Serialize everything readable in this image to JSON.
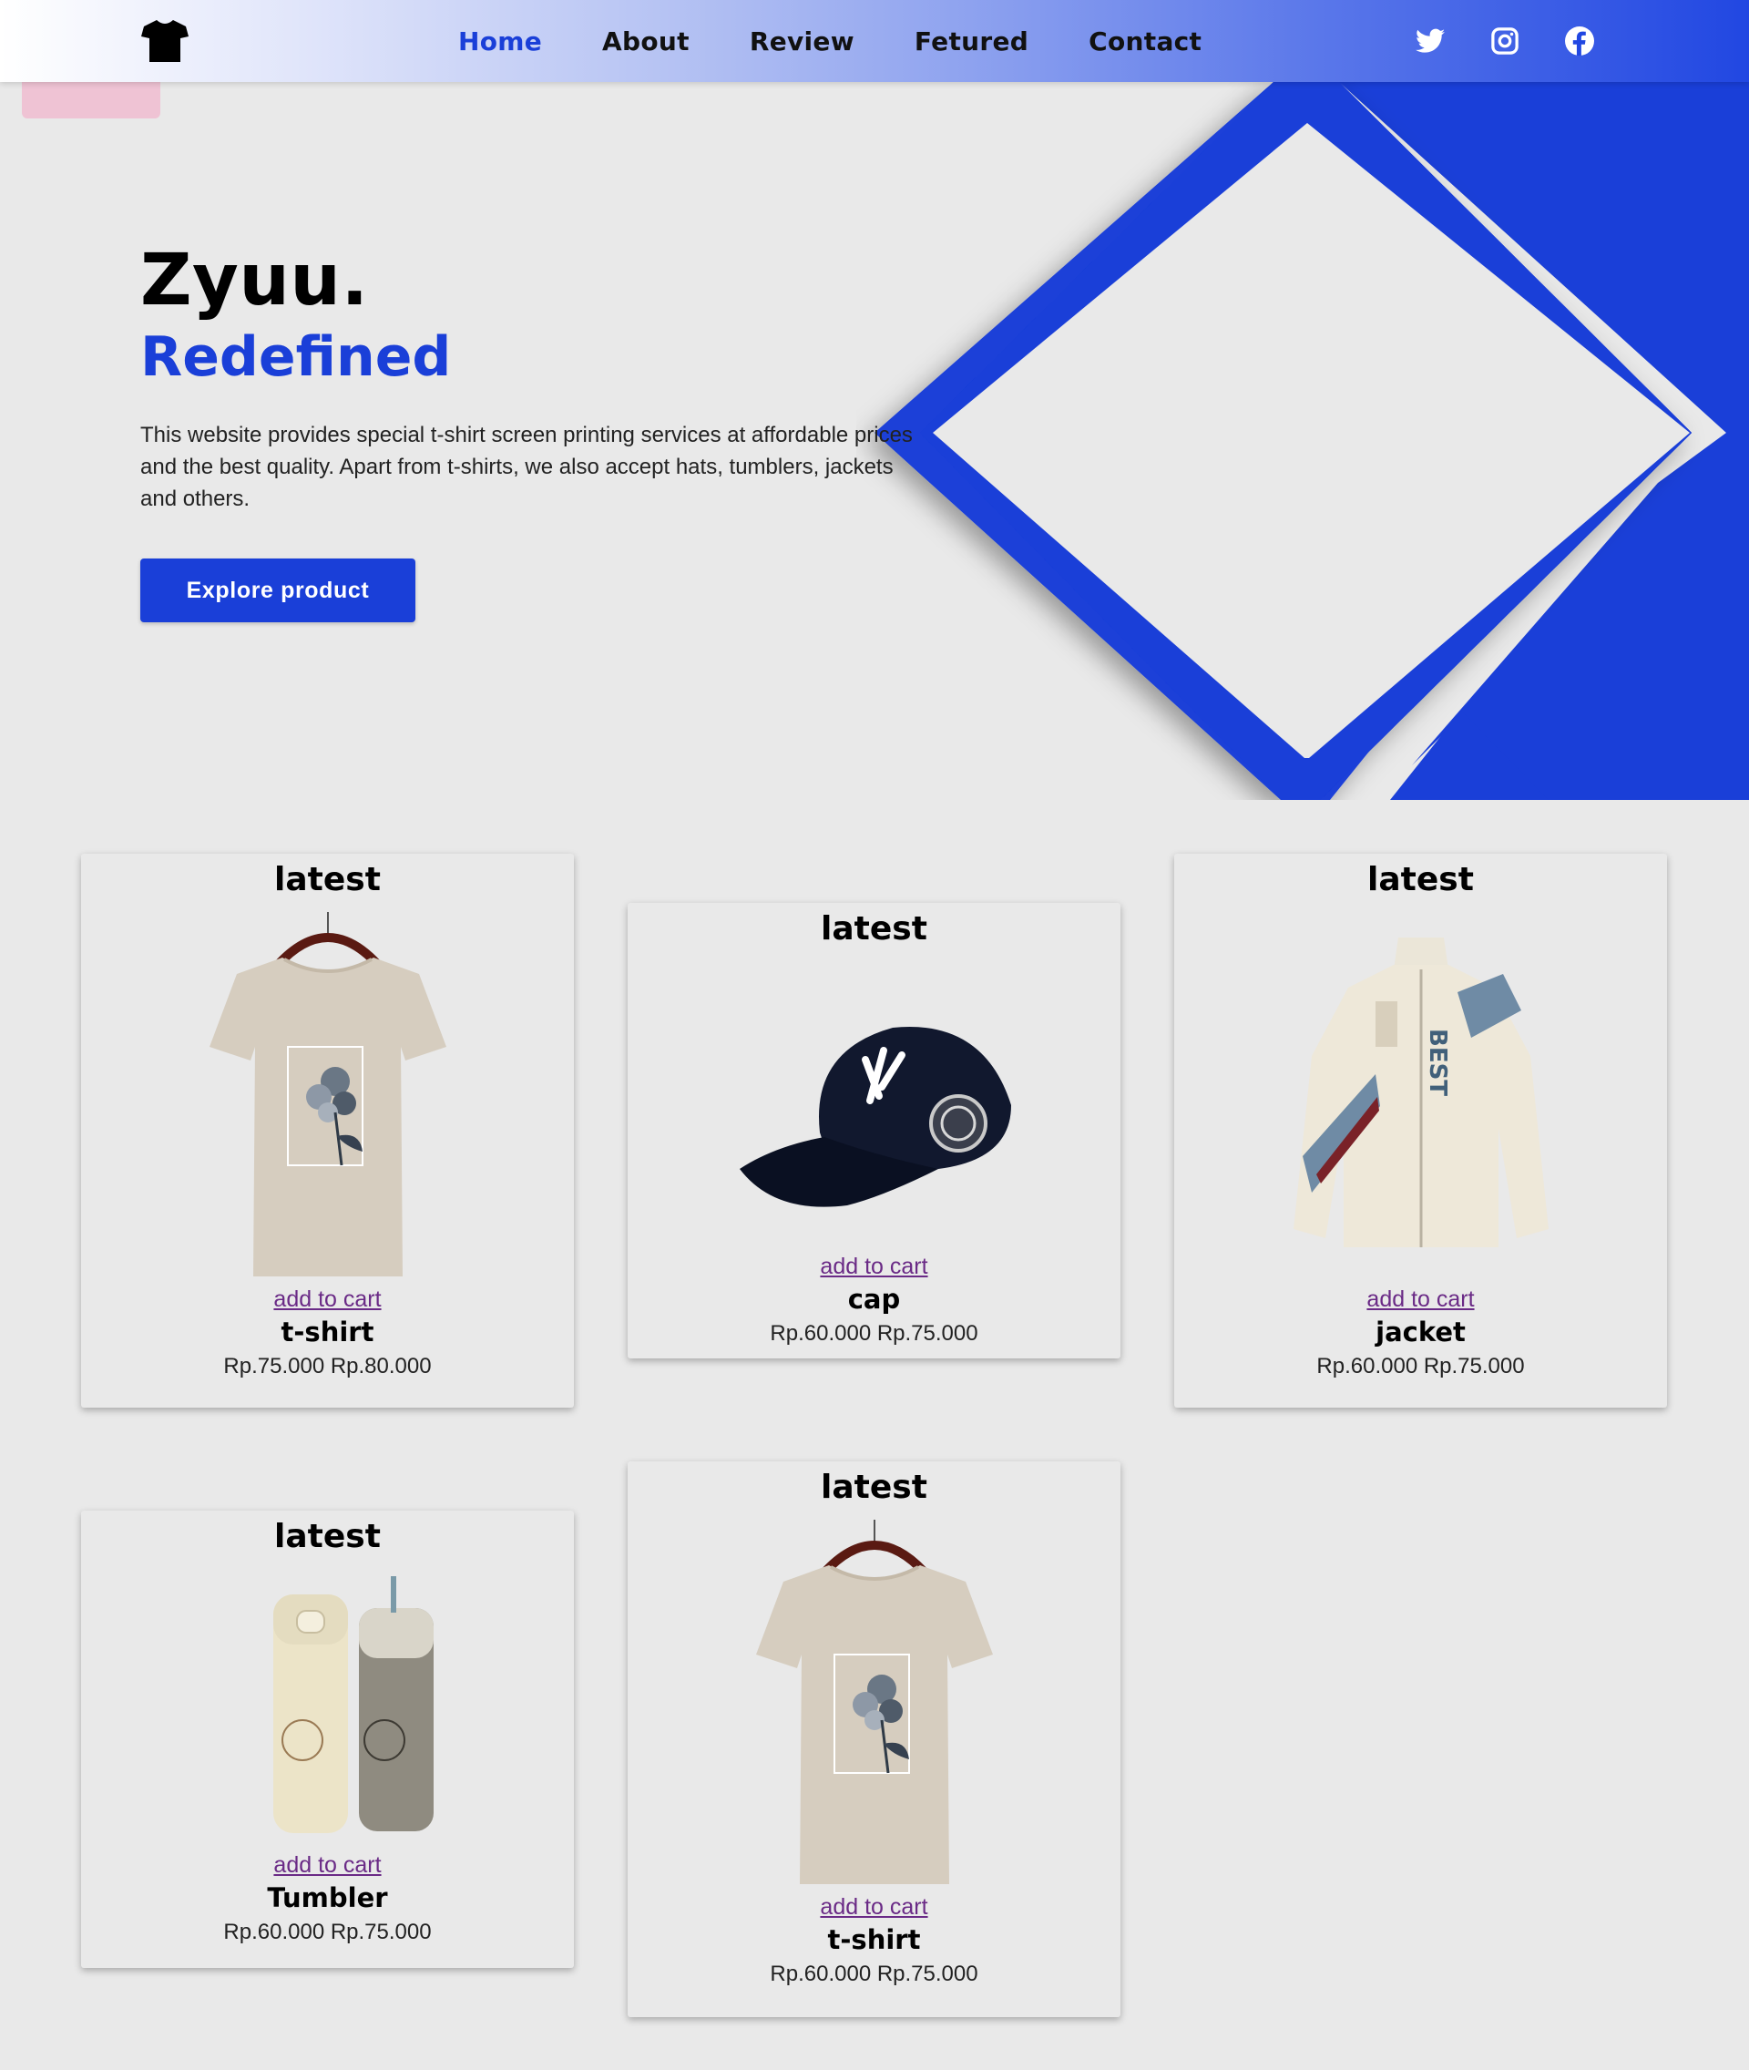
{
  "nav": {
    "links": [
      "Home",
      "About",
      "Review",
      "Fetured",
      "Contact"
    ],
    "active": "Home",
    "logo_icon": "tshirt-icon",
    "socials": [
      "twitter-icon",
      "instagram-icon",
      "facebook-icon"
    ]
  },
  "hero": {
    "title": "Zyuu.",
    "subtitle": "Redefined",
    "description": "This website provides special t-shirt screen printing services at affordable prices and the best quality. Apart from t-shirts, we also accept hats, tumblers, jackets and others.",
    "button": "Explore product"
  },
  "products": [
    {
      "tag": "latest",
      "cart": "add to cart",
      "name": "t-shirt",
      "price": "Rp.75.000 Rp.80.000"
    },
    {
      "tag": "latest",
      "cart": "add to cart",
      "name": "cap",
      "price": "Rp.60.000 Rp.75.000"
    },
    {
      "tag": "latest",
      "cart": "add to cart",
      "name": "jacket",
      "price": "Rp.60.000 Rp.75.000"
    },
    {
      "tag": "latest",
      "cart": "add to cart",
      "name": "Tumbler",
      "price": "Rp.60.000 Rp.75.000"
    },
    {
      "tag": "latest",
      "cart": "add to cart",
      "name": "t-shirt",
      "price": "Rp.60.000 Rp.75.000"
    }
  ],
  "colors": {
    "accent": "#1a3fd8",
    "background": "#e9e9e9",
    "link": "#6a2a86",
    "badge": "#efc3d4"
  }
}
